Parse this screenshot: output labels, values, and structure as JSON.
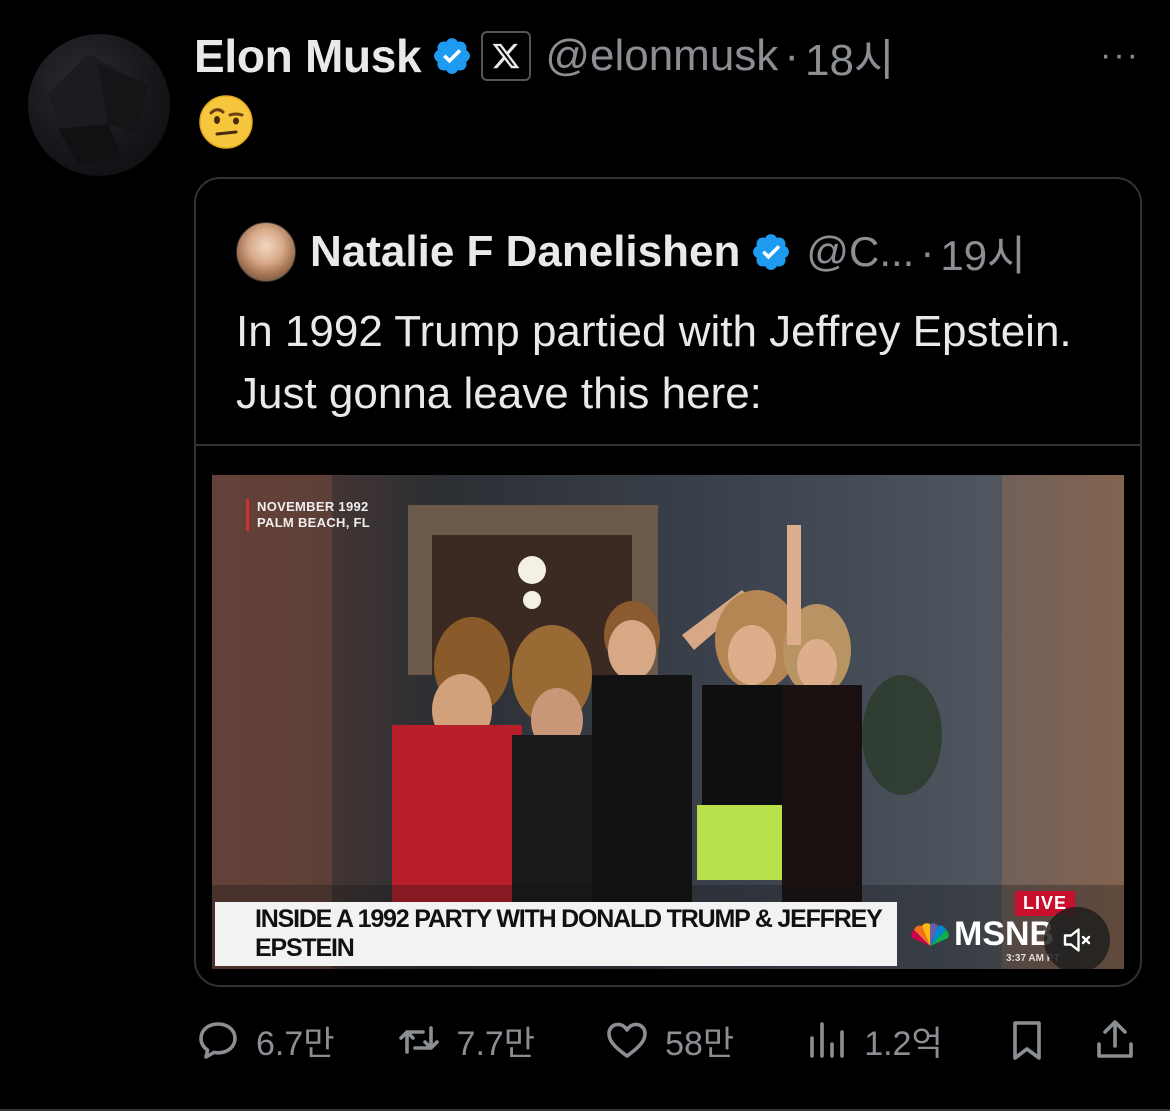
{
  "author": {
    "name": "Elon Musk",
    "handle": "@elonmusk",
    "separator": "·",
    "time": "18시",
    "more": "···"
  },
  "tweet": {
    "emoji": "raised-eyebrow-emoji"
  },
  "quoted": {
    "name": "Natalie F Danelishen",
    "handle": "@C...",
    "separator": "·",
    "time": "19시",
    "text": "In 1992 Trump partied with Jeffrey Epstein. Just gonna leave this here:"
  },
  "video": {
    "dateline_1": "NOVEMBER 1992",
    "dateline_2": "PALM BEACH, FL",
    "chyron": "INSIDE A 1992 PARTY WITH DONALD TRUMP & JEFFREY EPSTEIN",
    "live": "LIVE",
    "network": "MSNB",
    "clock": "3:37 AM PT"
  },
  "actions": {
    "replies": "6.7만",
    "reposts": "7.7만",
    "likes": "58만",
    "views": "1.2억"
  },
  "colors": {
    "verified": "#1d9bf0",
    "muted_text": "#8b8f94",
    "border": "#2f3336"
  }
}
